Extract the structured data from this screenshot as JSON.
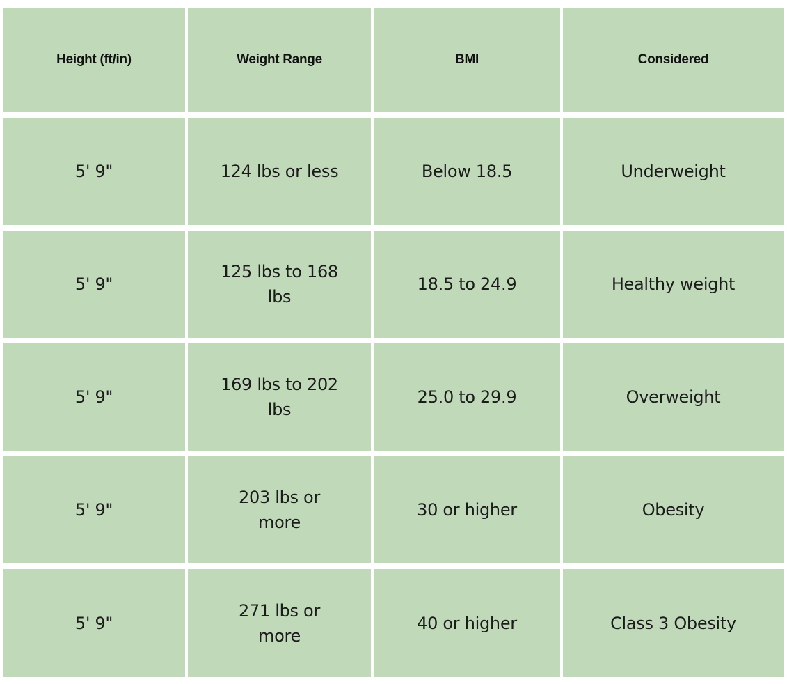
{
  "table": {
    "headers": [
      "Height (ft/in)",
      "Weight Range",
      "BMI",
      "Considered"
    ],
    "rows": [
      [
        "5' 9\"",
        "124 lbs or less",
        "Below 18.5",
        "Underweight"
      ],
      [
        "5' 9\"",
        "125 lbs to 168 lbs",
        "18.5 to 24.9",
        "Healthy weight"
      ],
      [
        "5' 9\"",
        "169 lbs to 202 lbs",
        "25.0 to 29.9",
        "Overweight"
      ],
      [
        "5' 9\"",
        "203 lbs or more",
        "30 or higher",
        "Obesity"
      ],
      [
        "5' 9\"",
        "271 lbs or more",
        "40 or higher",
        "Class 3 Obesity"
      ]
    ]
  },
  "colors": {
    "cell_bg": "#c0d9b9",
    "text": "#1b1b1b",
    "gap": "#ffffff"
  }
}
